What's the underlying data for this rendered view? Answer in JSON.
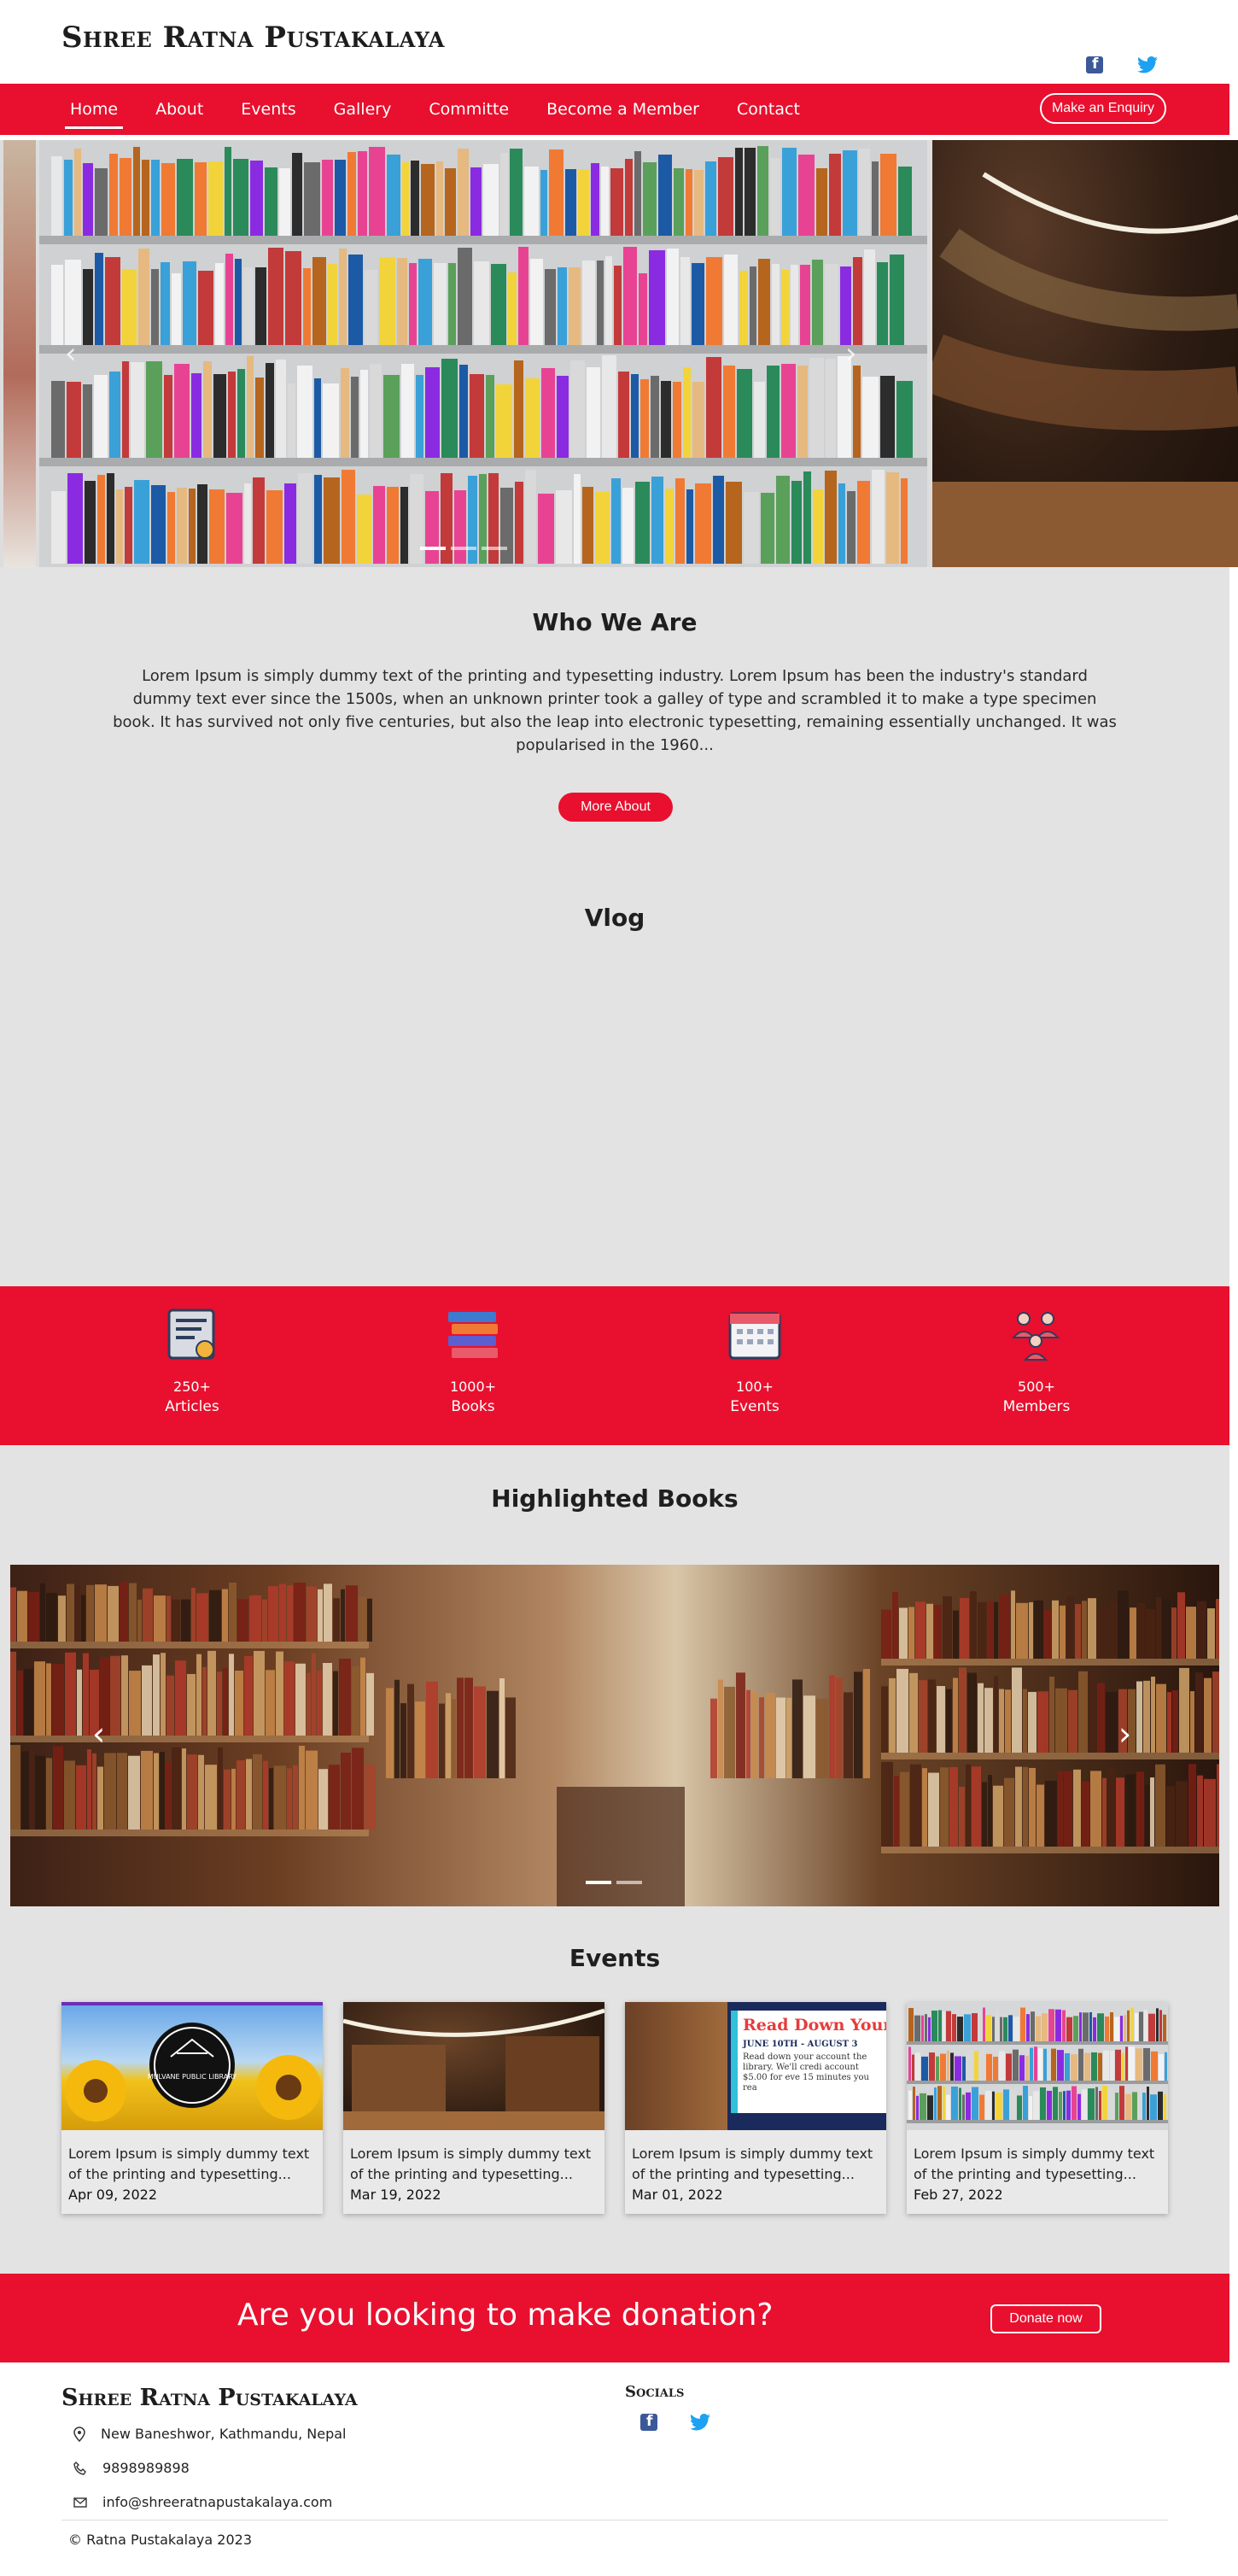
{
  "header": {
    "brand": "Shree Ratna Pustakalaya",
    "social": [
      "facebook-icon",
      "twitter-icon"
    ]
  },
  "nav": {
    "items": [
      "Home",
      "About",
      "Events",
      "Gallery",
      "Committe",
      "Become a Member",
      "Contact"
    ],
    "active": "Home",
    "enquiry": "Make an Enquiry"
  },
  "who": {
    "title": "Who We Are",
    "text": "Lorem Ipsum is simply dummy text of the printing and typesetting industry. Lorem Ipsum has been the industry's standard dummy text ever since the 1500s, when an unknown printer took a galley of type and scrambled it to make a type specimen book. It has survived not only five centuries, but also the leap into electronic typesetting, remaining essentially unchanged. It was popularised in the 1960...",
    "button": "More About"
  },
  "vlog": {
    "title": "Vlog"
  },
  "stats": [
    {
      "num": "250+",
      "label": "Articles",
      "icon": "certificate-icon"
    },
    {
      "num": "1000+",
      "label": "Books",
      "icon": "books-icon"
    },
    {
      "num": "100+",
      "label": "Events",
      "icon": "calendar-icon"
    },
    {
      "num": "500+",
      "label": "Members",
      "icon": "members-icon"
    }
  ],
  "highlighted": {
    "title": "Highlighted Books"
  },
  "events": {
    "title": "Events",
    "cards": [
      {
        "text": "Lorem Ipsum is simply dummy text of the printing and typesetting...",
        "date": "Apr 09, 2022",
        "image": "public-library-logo",
        "logo_text": "MULVANE PUBLIC LIBRARY"
      },
      {
        "text": "Lorem Ipsum is simply dummy text of the printing and typesetting...",
        "date": "Mar 19, 2022",
        "image": "library-interior"
      },
      {
        "text": "Lorem Ipsum is simply dummy text of the printing and typesetting...",
        "date": "Mar 01, 2022",
        "image": "read-down-poster",
        "poster_title": "Read Down Your",
        "poster_dates": "JUNE 10TH - AUGUST 3",
        "poster_body": "Read down your account the library. We'll credi account $5.00 for eve 15 minutes you rea"
      },
      {
        "text": "Lorem Ipsum is simply dummy text of the printing and typesetting...",
        "date": "Feb 27, 2022",
        "image": "bookshelf"
      }
    ]
  },
  "donation": {
    "text": "Are you looking to make donation?",
    "button": "Donate now"
  },
  "footer": {
    "brand": "Shree Ratna Pustakalaya",
    "address": "New Baneshwor, Kathmandu, Nepal",
    "phone": "9898989898",
    "email": "info@shreeratnapustakalaya.com",
    "socials_title": "Socials",
    "copyright": "© Ratna Pustakalaya 2023"
  },
  "colors": {
    "accent": "#e8102e",
    "band": "#e3e3e3",
    "facebook": "#3b5998",
    "twitter": "#1da1f2"
  }
}
